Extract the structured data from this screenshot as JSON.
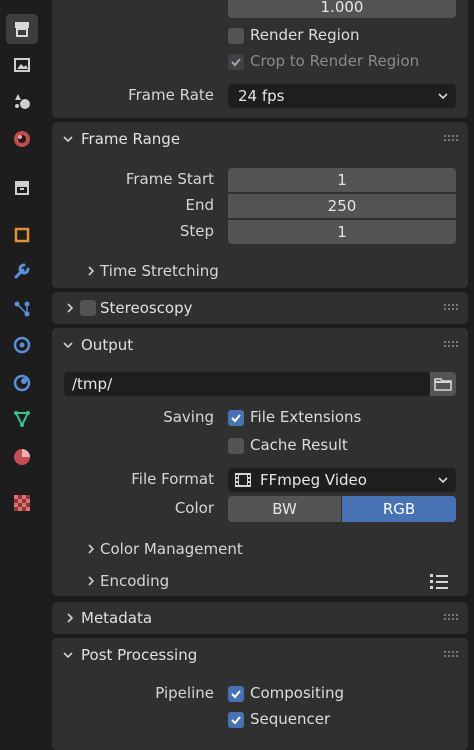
{
  "tabs": [
    {
      "name": "tool",
      "icon": "render-tab-icon",
      "active": true
    },
    {
      "name": "output",
      "icon": "output-tab-icon"
    },
    {
      "name": "view-layer",
      "icon": "view-layer-tab-icon"
    },
    {
      "name": "scene",
      "icon": "scene-tab-icon"
    },
    {
      "name": "world",
      "icon": "world-tab-icon"
    },
    {
      "name": "collection",
      "icon": "collection-tab-icon"
    },
    {
      "name": "object",
      "icon": "object-tab-icon"
    },
    {
      "name": "modifiers",
      "icon": "wrench-icon"
    },
    {
      "name": "particles",
      "icon": "particles-icon"
    },
    {
      "name": "physics",
      "icon": "physics-icon"
    },
    {
      "name": "constraints",
      "icon": "constraints-icon"
    },
    {
      "name": "data",
      "icon": "mesh-data-icon"
    },
    {
      "name": "material",
      "icon": "material-icon"
    },
    {
      "name": "texture",
      "icon": "texture-icon"
    }
  ],
  "format": {
    "top_value": "1.000",
    "render_region_label": "Render Region",
    "crop_label": "Crop to Render Region",
    "frame_rate_label": "Frame Rate",
    "frame_rate_value": "24 fps"
  },
  "frame_range": {
    "title": "Frame Range",
    "start_label": "Frame Start",
    "start_value": "1",
    "end_label": "End",
    "end_value": "250",
    "step_label": "Step",
    "step_value": "1",
    "time_stretching_label": "Time Stretching"
  },
  "stereoscopy": {
    "title": "Stereoscopy"
  },
  "output": {
    "title": "Output",
    "path_value": "/tmp/",
    "saving_label": "Saving",
    "file_extensions_label": "File Extensions",
    "cache_result_label": "Cache Result",
    "file_format_label": "File Format",
    "file_format_value": "FFmpeg Video",
    "color_label": "Color",
    "color_bw": "BW",
    "color_rgb": "RGB",
    "color_management_label": "Color Management",
    "encoding_label": "Encoding"
  },
  "metadata": {
    "title": "Metadata"
  },
  "post_processing": {
    "title": "Post Processing",
    "pipeline_label": "Pipeline",
    "compositing_label": "Compositing",
    "sequencer_label": "Sequencer"
  },
  "colors": {
    "accent": "#4772b3",
    "panel": "#303030",
    "field": "#545454"
  }
}
